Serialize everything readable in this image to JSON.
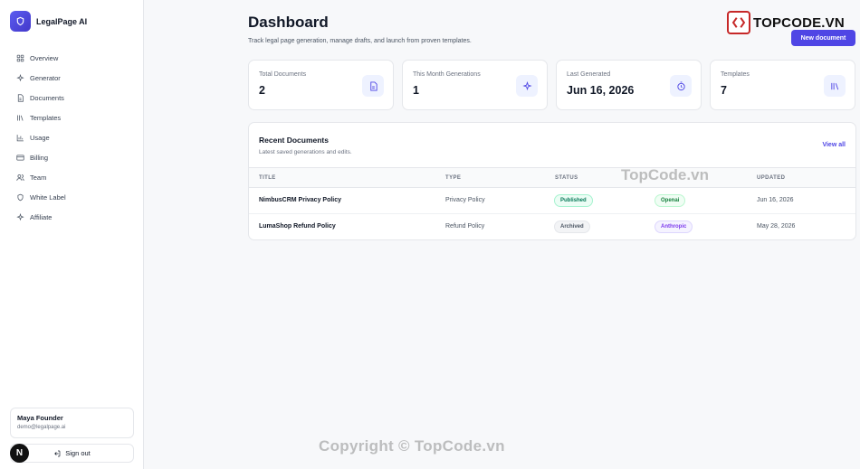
{
  "brand": {
    "name": "LegalPage AI"
  },
  "sidebar": {
    "items": [
      {
        "label": "Overview",
        "icon": "grid-icon"
      },
      {
        "label": "Generator",
        "icon": "sparkle-icon"
      },
      {
        "label": "Documents",
        "icon": "document-icon"
      },
      {
        "label": "Templates",
        "icon": "library-icon"
      },
      {
        "label": "Usage",
        "icon": "bar-chart-icon"
      },
      {
        "label": "Billing",
        "icon": "credit-card-icon"
      },
      {
        "label": "Team",
        "icon": "users-icon"
      },
      {
        "label": "White Label",
        "icon": "shield-icon"
      },
      {
        "label": "Affiliate",
        "icon": "sparkle-icon"
      }
    ],
    "user": {
      "name": "Maya Founder",
      "email": "demo@legalpage.ai"
    },
    "signout_label": "Sign out",
    "avatar_letter": "N"
  },
  "header": {
    "title": "Dashboard",
    "subtitle": "Track legal page generation, manage drafts, and launch from proven templates.",
    "new_button": "New document"
  },
  "stats": [
    {
      "label": "Total Documents",
      "value": "2",
      "icon": "document-icon"
    },
    {
      "label": "This Month Generations",
      "value": "1",
      "icon": "sparkle-icon"
    },
    {
      "label": "Last Generated",
      "value": "Jun 16, 2026",
      "icon": "timer-icon"
    },
    {
      "label": "Templates",
      "value": "7",
      "icon": "library-icon"
    }
  ],
  "recent": {
    "title": "Recent Documents",
    "subtitle": "Latest saved generations and edits.",
    "view_all": "View all",
    "columns": [
      "TITLE",
      "TYPE",
      "STATUS",
      "",
      "UPDATED"
    ],
    "rows": [
      {
        "title": "NimbusCRM Privacy Policy",
        "type": "Privacy Policy",
        "status": "Published",
        "provider": "Openai",
        "updated": "Jun 16, 2026"
      },
      {
        "title": "LumaShop Refund Policy",
        "type": "Refund Policy",
        "status": "Archived",
        "provider": "Anthropic",
        "updated": "May 28, 2026"
      }
    ]
  },
  "watermark": {
    "logo_text": "TOPCODE.VN",
    "center_text": "TopCode.vn",
    "bottom_text": "Copyright © TopCode.vn"
  },
  "colors": {
    "accent": "#4f46e5",
    "published_bg": "#ecfdf5",
    "published_fg": "#047857",
    "archived_bg": "#f3f4f6",
    "archived_fg": "#4b5563",
    "openai_bg": "#f0fdf4",
    "openai_fg": "#15803d",
    "anthropic_bg": "#f5f3ff",
    "anthropic_fg": "#7c3aed"
  }
}
